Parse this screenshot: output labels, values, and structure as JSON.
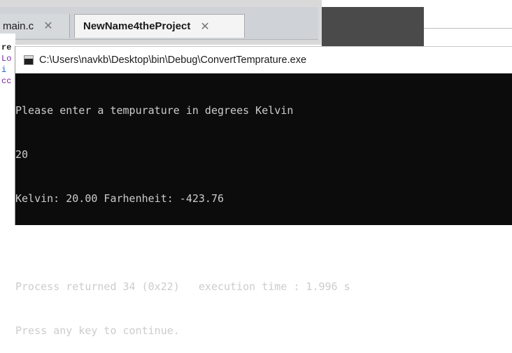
{
  "ide": {
    "tabs": [
      {
        "label": "main.c",
        "close": "✕"
      },
      {
        "label": "NewName4theProject",
        "close": "✕"
      }
    ],
    "code_fragments": [
      "re",
      "Lo",
      "i",
      "cc"
    ]
  },
  "console_window": {
    "title": "C:\\Users\\navkb\\Desktop\\bin\\Debug\\ConvertTemprature.exe",
    "lines": [
      "Please enter a tempurature in degrees Kelvin",
      "20",
      "Kelvin: 20.00 Farhenheit: -423.76",
      "",
      "Process returned 34 (0x22)   execution time : 1.996 s",
      "Press any key to continue."
    ]
  },
  "colors": {
    "console_bg": "#0c0c0c",
    "console_fg": "#cccccc",
    "code_keyword": "#7a1fa2",
    "code_blue": "#1f5fbf"
  }
}
